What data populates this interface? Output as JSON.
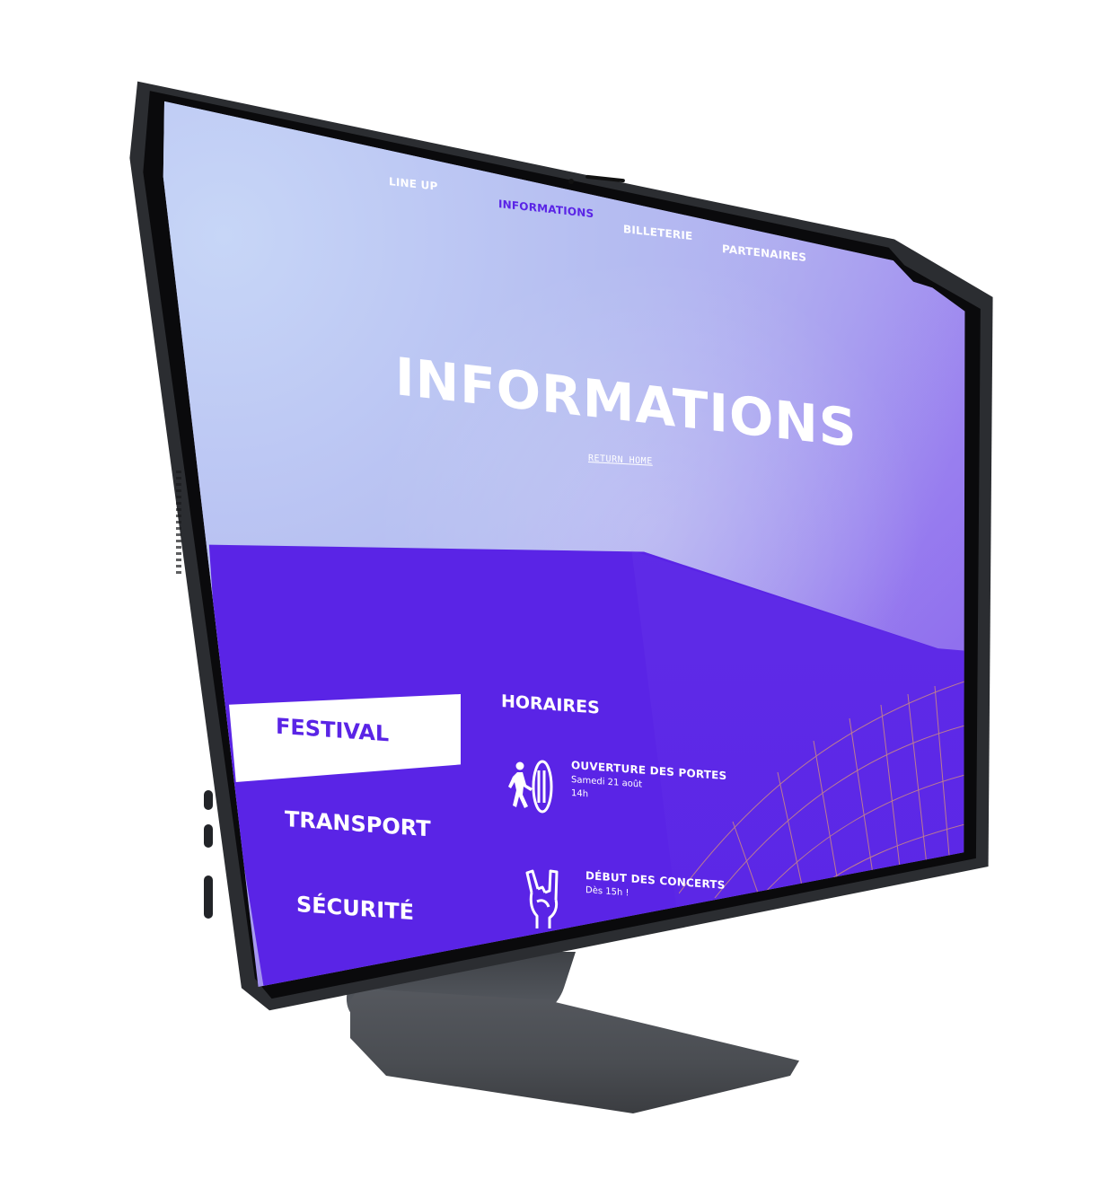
{
  "nav": {
    "items": [
      {
        "label": "LINE UP"
      },
      {
        "label": "INFORMATIONS"
      },
      {
        "label": "BILLETERIE"
      },
      {
        "label": "PARTENAIRES"
      }
    ]
  },
  "hero": {
    "title": "INFORMATIONS",
    "return_link": "RETURN HOME"
  },
  "tabs": {
    "active": "FESTIVAL",
    "transport": "TRANSPORT",
    "securite": "SÉCURITÉ"
  },
  "schedule": {
    "title": "HORAIRES",
    "items": [
      {
        "title": "OUVERTURE DES PORTES",
        "line1": "Samedi 21 août",
        "line2": "14h"
      },
      {
        "title": "DÉBUT DES CONCERTS",
        "line1": "Dès 15h !"
      }
    ]
  },
  "colors": {
    "accent": "#5a24e6",
    "light_gradient_start": "#c8d4f5",
    "grid_lines": "#e9a46a"
  },
  "icons": {
    "door": "door-entry-icon",
    "rock": "rock-hand-icon",
    "grid": "decorative-grid-icon"
  }
}
